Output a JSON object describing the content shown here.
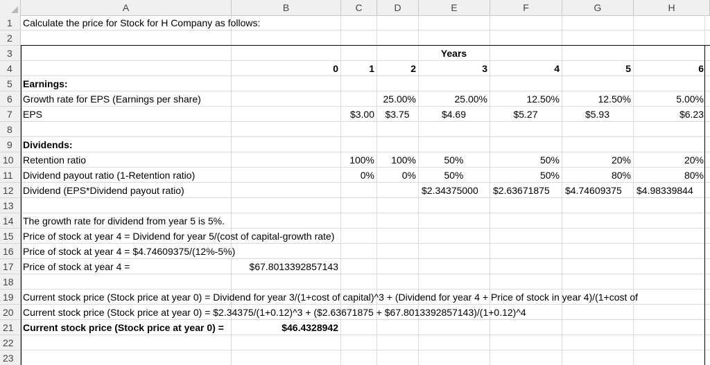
{
  "columns": [
    "A",
    "B",
    "C",
    "D",
    "E",
    "F",
    "G",
    "H"
  ],
  "rows": [
    "1",
    "2",
    "3",
    "4",
    "5",
    "6",
    "7",
    "8",
    "9",
    "10",
    "11",
    "12",
    "13",
    "14",
    "15",
    "16",
    "17",
    "18",
    "19",
    "20",
    "21",
    "22",
    "23"
  ],
  "cells": {
    "a1": "Calculate the price for Stock for H Company as follows:",
    "e3": "Years",
    "b4": "0",
    "c4": "1",
    "d4": "2",
    "e4": "3",
    "f4": "4",
    "g4": "5",
    "h4": "6",
    "a5": "Earnings:",
    "a6": "Growth rate for EPS (Earnings per share)",
    "d6": "25.00%",
    "e6": "25.00%",
    "f6": "12.50%",
    "g6": "12.50%",
    "h6": "5.00%",
    "a7": "EPS",
    "c7": "$3.00",
    "d7": "$3.75",
    "e7": "$4.69",
    "f7": "$5.27",
    "g7": "$5.93",
    "h7": "$6.23",
    "a9": "Dividends:",
    "a10": "Retention ratio",
    "c10": "100%",
    "d10": "100%",
    "e10": "50%",
    "f10": "50%",
    "g10": "20%",
    "h10": "20%",
    "a11": "Dividend payout ratio (1-Retention ratio)",
    "c11": "0%",
    "d11": "0%",
    "e11": "50%",
    "f11": "50%",
    "g11": "80%",
    "h11": "80%",
    "a12": "Dividend (EPS*Dividend payout ratio)",
    "e12": "$2.34375000",
    "f12": "$2.63671875",
    "g12": "$4.74609375",
    "h12": "$4.98339844",
    "a14": "The growth rate for dividend from year 5 is 5%.",
    "a15": "Price of stock at year 4 = Dividend for year 5/(cost of capital-growth rate)",
    "a16": "Price of stock at year 4 = $4.74609375/(12%-5%)",
    "a17": "Price of stock at year 4 =",
    "b17": "$67.8013392857143",
    "a19": "Current stock price (Stock price at year 0) = Dividend for year 3/(1+cost of capital)^3 + (Dividend for year 4 + Price of stock in year 4)/(1+cost of",
    "a20": "Current stock price (Stock price at year 0) = $2.34375/(1+0.12)^3 + ($2.63671875 + $67.8013392857143)/(1+0.12)^4",
    "a21": "Current stock price (Stock price at year 0) =",
    "b21": "$46.4328942"
  }
}
